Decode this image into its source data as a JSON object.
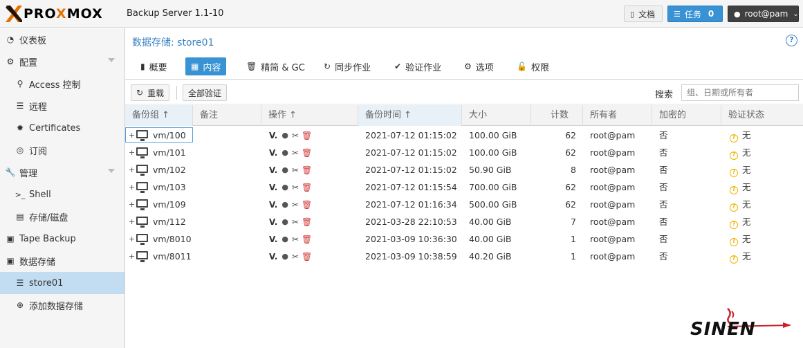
{
  "header": {
    "logo_pre": "PRO",
    "logo_x": "X",
    "logo_post": "MOX",
    "product": "Backup Server 1.1-10",
    "docs_label": "文档",
    "tasks_label": "任务",
    "tasks_count": "0",
    "user_label": "root@pam"
  },
  "sidebar": {
    "items": [
      {
        "label": "仪表板",
        "icon": "tachometer-icon"
      },
      {
        "label": "配置",
        "icon": "cogs-icon"
      },
      {
        "label": "Access 控制",
        "icon": "key-icon"
      },
      {
        "label": "远程",
        "icon": "server-icon"
      },
      {
        "label": "Certificates",
        "icon": "certificate-icon"
      },
      {
        "label": "订阅",
        "icon": "support-icon"
      },
      {
        "label": "管理",
        "icon": "wrench-icon"
      },
      {
        "label": "Shell",
        "icon": "terminal-icon"
      },
      {
        "label": "存储/磁盘",
        "icon": "hdd-icon"
      },
      {
        "label": "Tape Backup",
        "icon": "tape-icon"
      },
      {
        "label": "数据存储",
        "icon": "archive-icon"
      },
      {
        "label": "store01",
        "icon": "database-icon"
      },
      {
        "label": "添加数据存储",
        "icon": "plus-circle-icon"
      }
    ]
  },
  "main": {
    "title": "数据存储: store01",
    "tabs": [
      {
        "label": "概要",
        "icon": "book-icon"
      },
      {
        "label": "内容",
        "icon": "th-icon"
      },
      {
        "label": "精简 & GC",
        "icon": "trash-icon"
      },
      {
        "label": "同步作业",
        "icon": "refresh-icon"
      },
      {
        "label": "验证作业",
        "icon": "check-circle-icon"
      },
      {
        "label": "选项",
        "icon": "gear-icon"
      },
      {
        "label": "权限",
        "icon": "unlock-icon"
      }
    ],
    "toolbar": {
      "reload_label": "重载",
      "verify_all_label": "全部验证",
      "search_label": "搜索",
      "search_placeholder": "组、日期或所有者"
    },
    "columns": [
      "备份组 ↑",
      "备注",
      "操作 ↑",
      "备份时间 ↑",
      "大小",
      "计数",
      "所有者",
      "加密的",
      "验证状态"
    ],
    "rows": [
      {
        "group": "vm/100",
        "time": "2021-07-12 01:15:02",
        "size": "100.00 GiB",
        "count": "62",
        "owner": "root@pam",
        "encrypted": "否",
        "verify": "无"
      },
      {
        "group": "vm/101",
        "time": "2021-07-12 01:15:02",
        "size": "100.00 GiB",
        "count": "62",
        "owner": "root@pam",
        "encrypted": "否",
        "verify": "无"
      },
      {
        "group": "vm/102",
        "time": "2021-07-12 01:15:02",
        "size": "50.90 GiB",
        "count": "8",
        "owner": "root@pam",
        "encrypted": "否",
        "verify": "无"
      },
      {
        "group": "vm/103",
        "time": "2021-07-12 01:15:54",
        "size": "700.00 GiB",
        "count": "62",
        "owner": "root@pam",
        "encrypted": "否",
        "verify": "无"
      },
      {
        "group": "vm/109",
        "time": "2021-07-12 01:16:34",
        "size": "500.00 GiB",
        "count": "62",
        "owner": "root@pam",
        "encrypted": "否",
        "verify": "无"
      },
      {
        "group": "vm/112",
        "time": "2021-03-28 22:10:53",
        "size": "40.00 GiB",
        "count": "7",
        "owner": "root@pam",
        "encrypted": "否",
        "verify": "无"
      },
      {
        "group": "vm/8010",
        "time": "2021-03-09 10:36:30",
        "size": "40.00 GiB",
        "count": "1",
        "owner": "root@pam",
        "encrypted": "否",
        "verify": "无"
      },
      {
        "group": "vm/8011",
        "time": "2021-03-09 10:38:59",
        "size": "40.20 GiB",
        "count": "1",
        "owner": "root@pam",
        "encrypted": "否",
        "verify": "无"
      }
    ],
    "action_v": "V."
  },
  "watermark": "SINEN",
  "colors": {
    "accent": "#3892d4",
    "selected": "#c2ddf2",
    "logo_orange": "#e57000"
  }
}
